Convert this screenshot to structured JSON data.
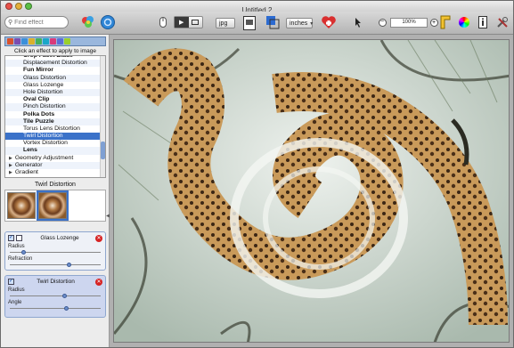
{
  "window": {
    "title": "Untitled 2"
  },
  "toolbar": {
    "search_placeholder": "Find effect",
    "format": "jpg",
    "units": "inches",
    "zoom": "100%"
  },
  "sidebar": {
    "hint": "Click an effect to apply to image",
    "effects": [
      {
        "label": "Crop Facet Blade",
        "bold": true
      },
      {
        "label": "Displacement Distortion"
      },
      {
        "label": "Fun Mirror",
        "bold": true
      },
      {
        "label": "Glass Distortion"
      },
      {
        "label": "Glass Lozenge"
      },
      {
        "label": "Hole Distortion"
      },
      {
        "label": "Oval Clip",
        "bold": true
      },
      {
        "label": "Pinch Distortion"
      },
      {
        "label": "Polka Dots",
        "bold": true
      },
      {
        "label": "Tile Puzzle",
        "bold": true
      },
      {
        "label": "Torus Lens Distortion"
      },
      {
        "label": "Twirl Distortion",
        "selected": true
      },
      {
        "label": "Vortex Distortion"
      },
      {
        "label": "Lens",
        "bold": true
      },
      {
        "label": "Geometry Adjustment",
        "group": true
      },
      {
        "label": "Generator",
        "group": true
      },
      {
        "label": "Gradient",
        "group": true
      }
    ],
    "selected_effect": "Twirl Distortion",
    "layers": [
      {
        "name": "Glass Lozenge",
        "enabled": true,
        "params": [
          {
            "label": "Radius",
            "value": 0.15
          },
          {
            "label": "Refraction",
            "value": 0.65
          }
        ]
      },
      {
        "name": "Twirl Distortion",
        "enabled": true,
        "params": [
          {
            "label": "Radius",
            "value": 0.6
          },
          {
            "label": "Angle",
            "value": 0.62
          }
        ]
      }
    ]
  },
  "colors": {
    "selection": "#3b72c9",
    "layer_bg": "#cdd6ef",
    "delete": "#d62323"
  }
}
